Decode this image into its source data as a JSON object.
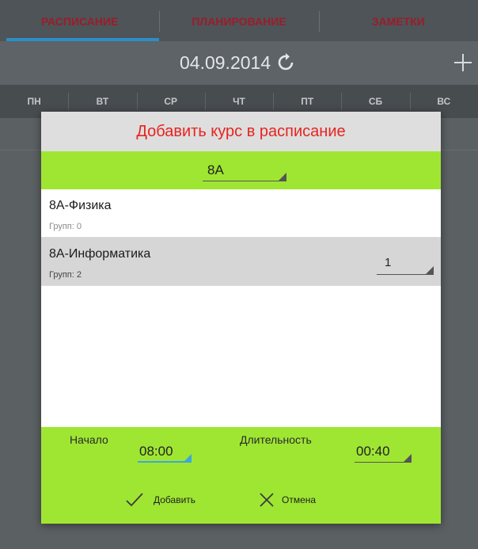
{
  "tabs": [
    {
      "label": "РАСПИСАНИЕ",
      "active": true
    },
    {
      "label": "ПЛАНИРОВАНИЕ",
      "active": false
    },
    {
      "label": "ЗАМЕТКИ",
      "active": false
    }
  ],
  "datebar": {
    "date": "04.09.2014",
    "refresh_icon": "refresh-icon",
    "add_icon": "plus-icon"
  },
  "weekdays": [
    "ПН",
    "ВТ",
    "СР",
    "ЧТ",
    "ПТ",
    "СБ",
    "ВС"
  ],
  "dialog": {
    "title": "Добавить курс в расписание",
    "class_selector": {
      "value": "8А"
    },
    "courses": [
      {
        "name": "8А-Физика",
        "groups": "Групп: 0",
        "selected": false
      },
      {
        "name": "8А-Информатика",
        "groups": "Групп: 2",
        "selected": true,
        "group_spinner": "1"
      }
    ],
    "start": {
      "label": "Начало",
      "value": "08:00"
    },
    "duration": {
      "label": "Длительность",
      "value": "00:40"
    },
    "actions": {
      "add_label": "Добавить",
      "cancel_label": "Отмена"
    }
  },
  "colors": {
    "accent_green": "#9fe633",
    "title_red": "#e8231f",
    "tab_red": "#9b1c2c",
    "tab_indicator": "#2b8fc5"
  }
}
